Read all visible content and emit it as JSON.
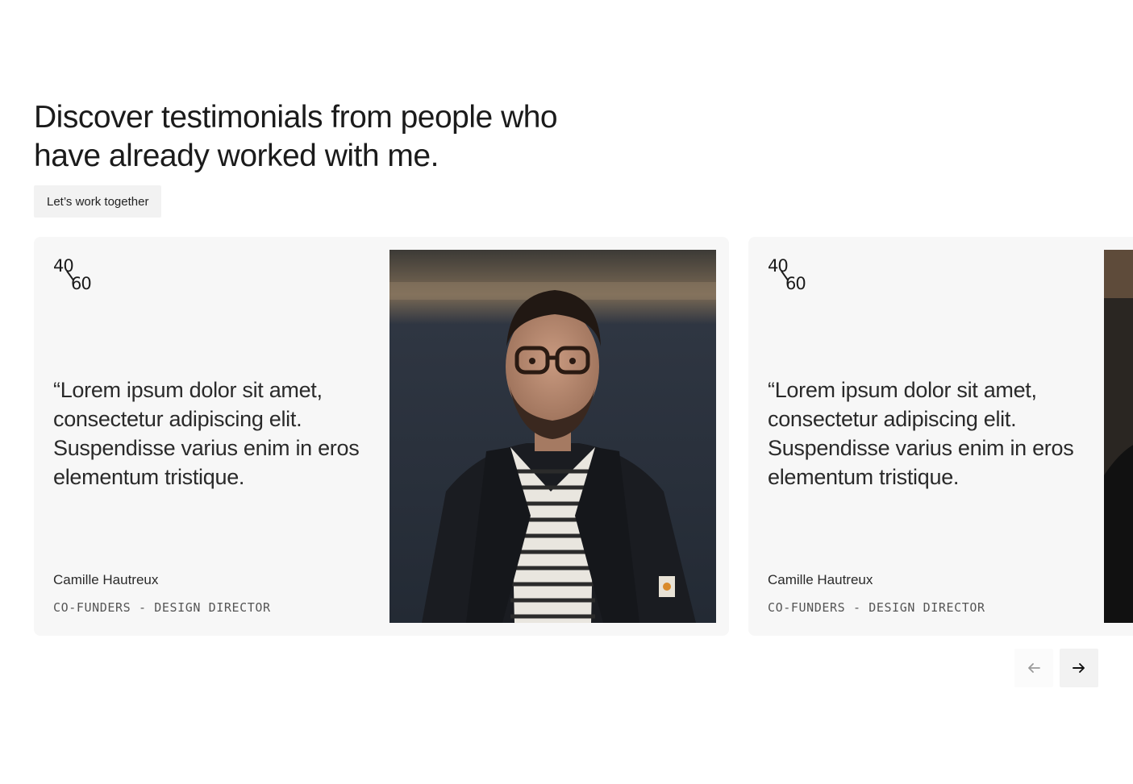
{
  "section": {
    "headline": "Discover testimonials from people who have already worked with me.",
    "cta_label": "Let’s work together"
  },
  "testimonials": [
    {
      "logo_top": "40",
      "logo_bottom": "60",
      "quote": "“Lorem ipsum dolor sit amet, consectetur adipiscing elit. Suspendisse varius enim in eros elementum tristique.",
      "name": "Camille Hautreux",
      "role": "CO-FUNDERS - DESIGN DIRECTOR"
    },
    {
      "logo_top": "40",
      "logo_bottom": "60",
      "quote": "“Lorem ipsum dolor sit amet, consectetur adipiscing elit. Suspendisse varius enim in eros elementum tristique.",
      "name": "Camille Hautreux",
      "role": "CO-FUNDERS - DESIGN DIRECTOR"
    }
  ],
  "navigation": {
    "prev_icon": "arrow-left-icon",
    "next_icon": "arrow-right-icon"
  },
  "colors": {
    "card_background": "#f7f7f7",
    "text": "#1b1b1b",
    "button_background": "#f2f2f2"
  }
}
